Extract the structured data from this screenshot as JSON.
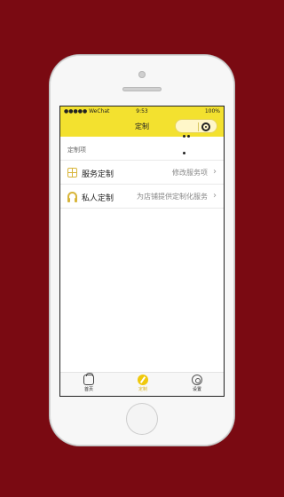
{
  "status_bar": {
    "carrier": "●●●●● WeChat",
    "time": "9:53",
    "battery": "100%"
  },
  "nav": {
    "title": "定制"
  },
  "section": {
    "title": "定制项"
  },
  "rows": [
    {
      "label": "服务定制",
      "value": "修改服务项",
      "icon": "grid-icon"
    },
    {
      "label": "私人定制",
      "value": "为店铺提供定制化服务",
      "icon": "headset-icon"
    }
  ],
  "tabs": [
    {
      "label": "首页",
      "icon": "car-icon",
      "active": false
    },
    {
      "label": "定制",
      "icon": "pen-icon",
      "active": true
    },
    {
      "label": "设置",
      "icon": "gear-icon",
      "active": false
    }
  ],
  "colors": {
    "accent": "#f3e12f",
    "background": "#7a0a12",
    "active_tab": "#d8b21b"
  }
}
